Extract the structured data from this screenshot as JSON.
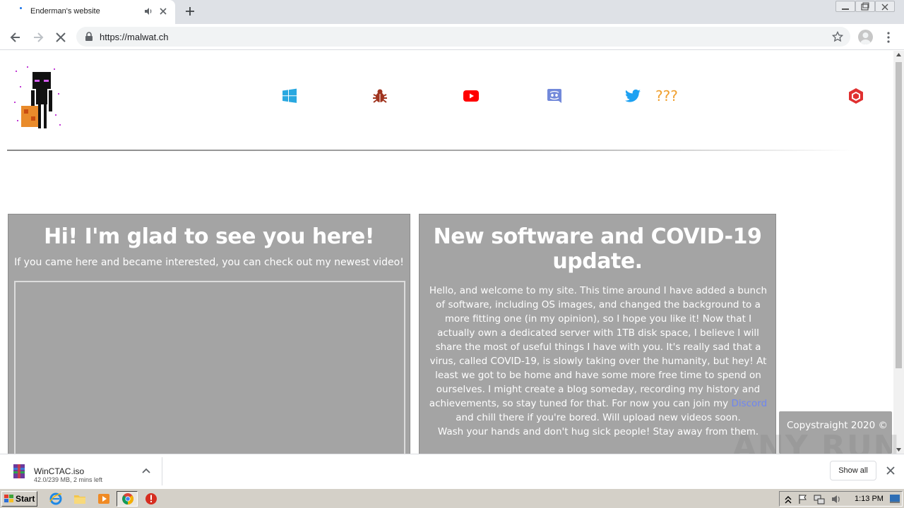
{
  "browser": {
    "tab": {
      "title": "Enderman's website"
    },
    "url": "https://malwat.ch"
  },
  "site": {
    "nav": {
      "links": [
        {
          "icon": "windows-icon",
          "color": "#29a8e0"
        },
        {
          "icon": "bug-icon",
          "color": "#a0341f"
        },
        {
          "icon": "youtube-icon",
          "color": "#ff0000"
        },
        {
          "icon": "discord-icon",
          "color": "#7289da"
        },
        {
          "icon": "twitter-icon",
          "color": "#1da1f2"
        },
        {
          "icon": "cube-icon",
          "color": "#e03030"
        }
      ],
      "mystery_label": "???"
    },
    "welcome_card": {
      "heading": "Hi! I'm glad to see you here!",
      "subtext": "If you came here and became interested, you can check out my newest video!"
    },
    "news_card": {
      "heading": "New software and COVID-19 update.",
      "body_before_link": "Hello, and welcome to my site. This time around I have added a bunch of software, including OS images, and changed the background to a more fitting one (in my opinion), so I hope you like it! Now that I actually own a dedicated server with 1TB disk space, I believe I will share the most of useful things I have with you. It's really sad that a virus, called COVID-19, is slowly taking over the humanity, but hey! At least we got to be home and have some more free time to spend on ourselves. I might create a blog someday, recording my history and achievements, so stay tuned for that. For now you can join my",
      "link_text": "Discord",
      "body_after_link": "and chill there if you're bored. Will upload new videos soon.",
      "closing_line": "Wash your hands and don't hug sick people! Stay away from them."
    },
    "footer": {
      "copyright": "Copystraight 2020 ©"
    },
    "colors": {
      "card_bg": "#a4a4a4",
      "link": "#6f86f0",
      "mystery": "#f0a030"
    }
  },
  "watermark": "ANY RUN",
  "download_shelf": {
    "file_name": "WinCTAC.iso",
    "status": "42.0/239 MB, 2 mins left",
    "show_all_label": "Show all"
  },
  "taskbar": {
    "start_label": "Start",
    "clock": "1:13 PM"
  }
}
